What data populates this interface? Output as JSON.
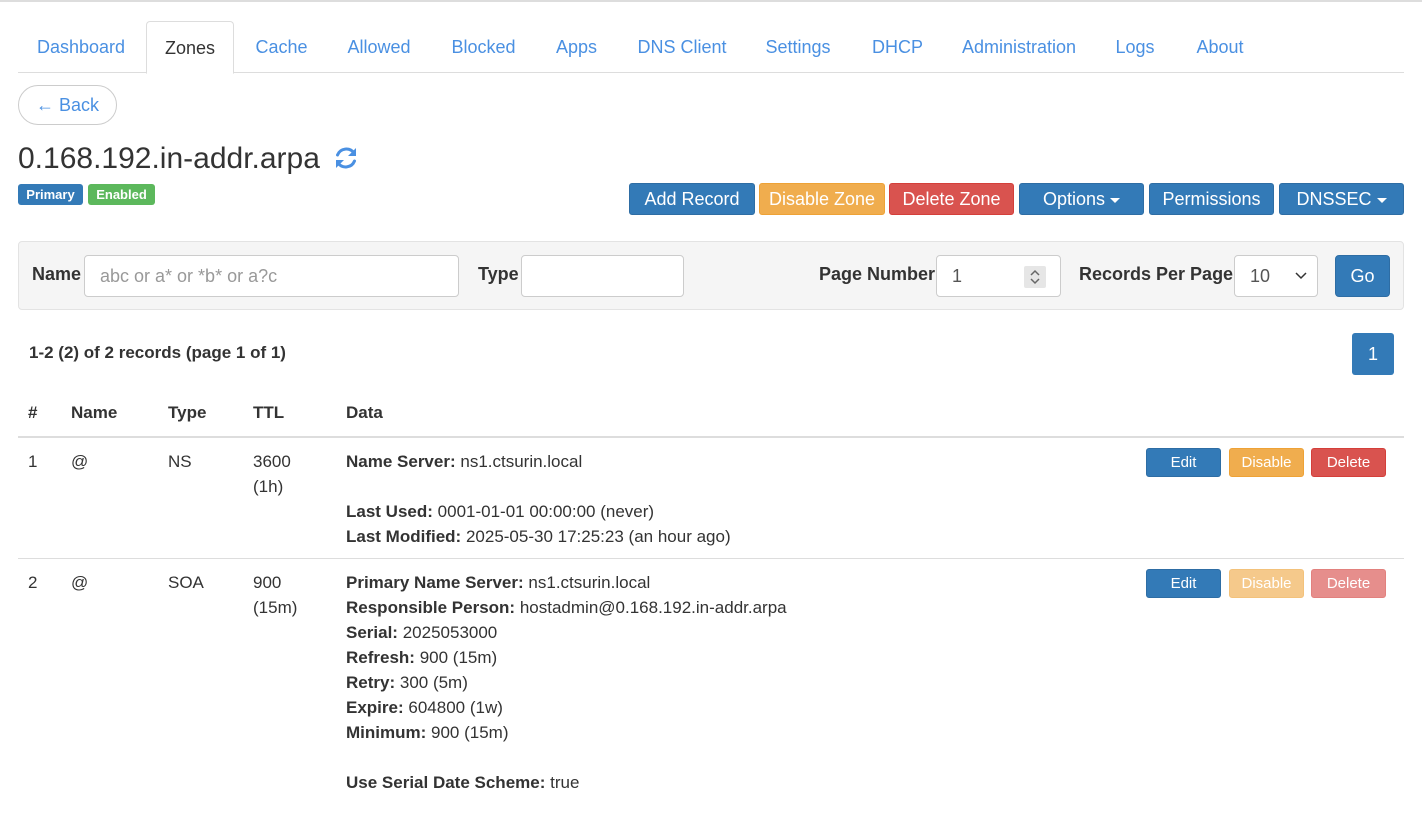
{
  "tabs": [
    {
      "label": "Dashboard"
    },
    {
      "label": "Zones"
    },
    {
      "label": "Cache"
    },
    {
      "label": "Allowed"
    },
    {
      "label": "Blocked"
    },
    {
      "label": "Apps"
    },
    {
      "label": "DNS Client"
    },
    {
      "label": "Settings"
    },
    {
      "label": "DHCP"
    },
    {
      "label": "Administration"
    },
    {
      "label": "Logs"
    },
    {
      "label": "About"
    }
  ],
  "active_tab": "Zones",
  "back_label": "← Back",
  "zone": {
    "title": "0.168.192.in-addr.arpa",
    "badges": {
      "type": "Primary",
      "status": "Enabled"
    }
  },
  "actions": {
    "add_record": "Add Record",
    "disable_zone": "Disable Zone",
    "delete_zone": "Delete Zone",
    "options": "Options",
    "permissions": "Permissions",
    "dnssec": "DNSSEC"
  },
  "filter": {
    "name_label": "Name",
    "name_placeholder": "abc or a* or *b* or a?c",
    "type_label": "Type",
    "type_value": "",
    "page_number_label": "Page Number",
    "page_number_value": "1",
    "records_per_page_label": "Records Per Page",
    "records_per_page_value": "10",
    "go_label": "Go"
  },
  "summary": "1-2 (2) of 2 records (page 1 of 1)",
  "pagination": {
    "current": "1"
  },
  "table": {
    "headers": {
      "num": "#",
      "name": "Name",
      "type": "Type",
      "ttl": "TTL",
      "data": "Data"
    },
    "rows": [
      {
        "num": "1",
        "name": "@",
        "type": "NS",
        "ttl": "3600",
        "ttl_human": "(1h)",
        "ns_label": "Name Server:",
        "ns_value": "ns1.ctsurin.local",
        "last_used_label": "Last Used:",
        "last_used_value": "0001-01-01 00:00:00 (never)",
        "last_modified_label": "Last Modified:",
        "last_modified_value": "2025-05-30 17:25:23 (an hour ago)",
        "edit": "Edit",
        "disable": "Disable",
        "delete": "Delete"
      },
      {
        "num": "2",
        "name": "@",
        "type": "SOA",
        "ttl": "900",
        "ttl_human": "(15m)",
        "fields": [
          {
            "label": "Primary Name Server:",
            "value": "ns1.ctsurin.local"
          },
          {
            "label": "Responsible Person:",
            "value": "hostadmin@0.168.192.in-addr.arpa"
          },
          {
            "label": "Serial:",
            "value": "2025053000"
          },
          {
            "label": "Refresh:",
            "value": "900 (15m)"
          },
          {
            "label": "Retry:",
            "value": "300 (5m)"
          },
          {
            "label": "Expire:",
            "value": "604800 (1w)"
          },
          {
            "label": "Minimum:",
            "value": "900 (15m)"
          }
        ],
        "serial_scheme_label": "Use Serial Date Scheme:",
        "serial_scheme_value": "true",
        "edit": "Edit",
        "disable": "Disable",
        "delete": "Delete"
      }
    ]
  },
  "colors": {
    "primary": "#337ab7",
    "warning": "#f0ad4e",
    "danger": "#d9534f",
    "success": "#5cb85c",
    "link": "#4a90e2"
  },
  "icons": {
    "refresh": "refresh-icon",
    "spinner": "stepper-icon",
    "select": "chevron-down-icon"
  }
}
